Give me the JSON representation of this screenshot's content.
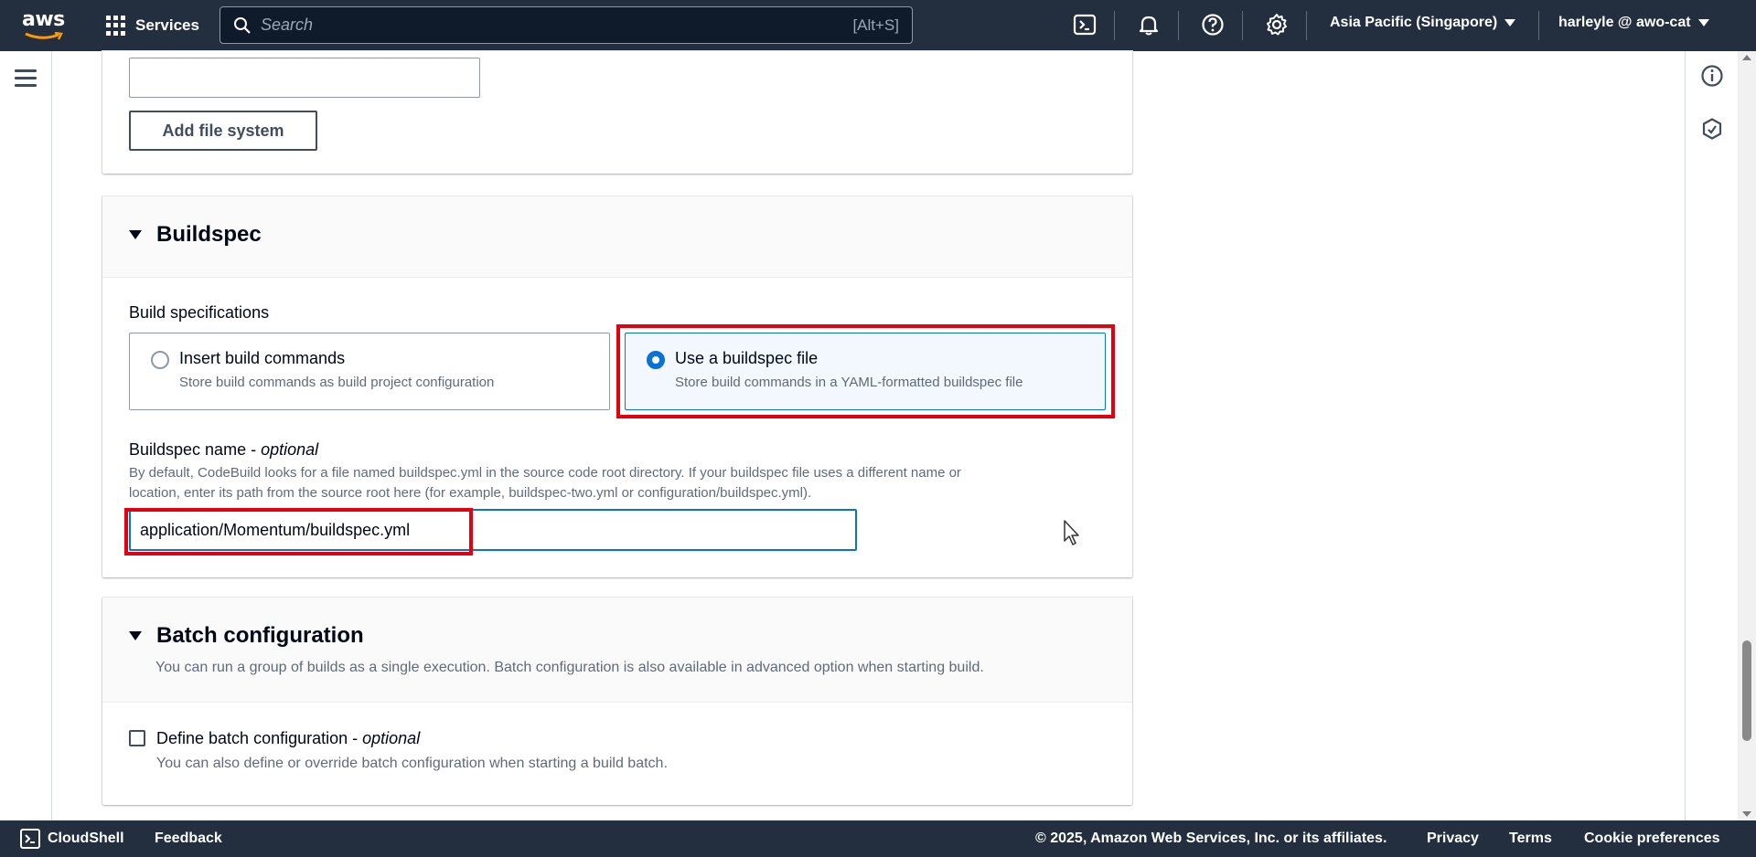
{
  "topnav": {
    "logo_text": "aws",
    "services_label": "Services",
    "search_placeholder": "Search",
    "search_shortcut": "[Alt+S]",
    "region_label": "Asia Pacific (Singapore)",
    "account_label": "harleyle @ awo-cat",
    "icons": [
      "cloudshell-icon",
      "bell-icon",
      "help-icon",
      "settings-icon"
    ]
  },
  "filesystem": {
    "input_value": "",
    "add_button_label": "Add file system"
  },
  "buildspec": {
    "section_title": "Buildspec",
    "build_specifications_label": "Build specifications",
    "options": [
      {
        "title": "Insert build commands",
        "description": "Store build commands as build project configuration",
        "selected": false
      },
      {
        "title": "Use a buildspec file",
        "description": "Store build commands in a YAML-formatted buildspec file",
        "selected": true
      }
    ],
    "name_label": "Buildspec name - ",
    "name_label_optional": "optional",
    "name_description_line1": "By default, CodeBuild looks for a file named buildspec.yml in the source code root directory. If your buildspec file uses a different name or",
    "name_description_line2": "location, enter its path from the source root here (for example, buildspec-two.yml or configuration/buildspec.yml).",
    "name_value": "application/Momentum/buildspec.yml"
  },
  "batch": {
    "section_title": "Batch configuration",
    "section_description": "You can run a group of builds as a single execution. Batch configuration is also available in advanced option when starting build.",
    "checkbox_label": "Define batch configuration - ",
    "checkbox_label_optional": "optional",
    "checkbox_description": "You can also define or override batch configuration when starting a build batch.",
    "checked": false
  },
  "footer": {
    "cloudshell_label": "CloudShell",
    "feedback_label": "Feedback",
    "copyright": "© 2025, Amazon Web Services, Inc. or its affiliates.",
    "privacy_label": "Privacy",
    "terms_label": "Terms",
    "cookie_label": "Cookie preferences"
  },
  "colors": {
    "nav_bg": "#232f3e",
    "accent_blue": "#0972d3",
    "highlight_red": "#e3000f"
  }
}
